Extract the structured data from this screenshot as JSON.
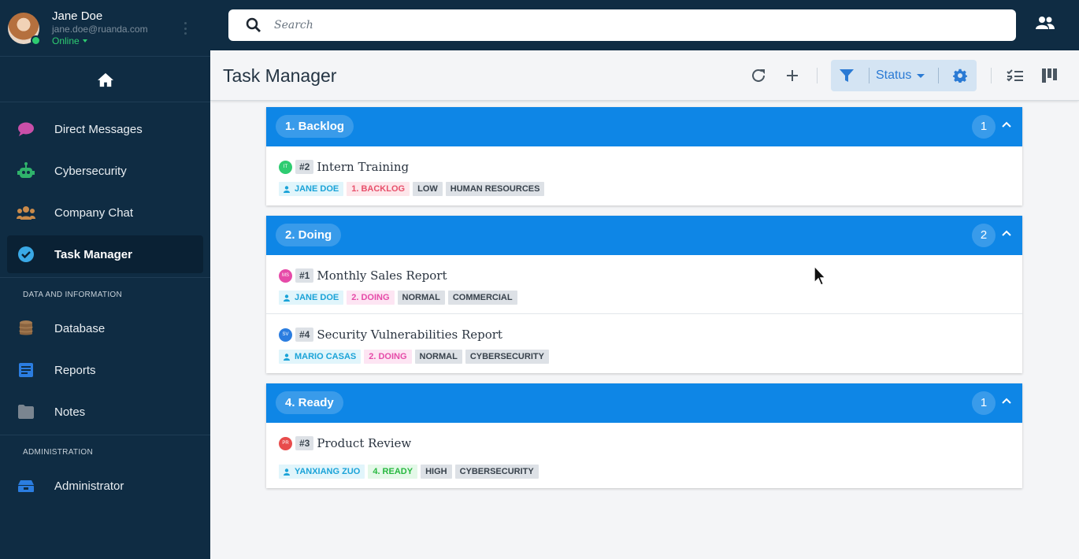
{
  "user": {
    "name": "Jane Doe",
    "email": "jane.doe@ruanda.com",
    "status": "Online"
  },
  "search": {
    "placeholder": "Search"
  },
  "sidebar": {
    "items": [
      {
        "label": "Direct Messages",
        "icon": "chat-bubble-icon",
        "color": "#c94fa8"
      },
      {
        "label": "Cybersecurity",
        "icon": "robot-icon",
        "color": "#2fb36b"
      },
      {
        "label": "Company Chat",
        "icon": "group-icon",
        "color": "#c98a4a"
      },
      {
        "label": "Task Manager",
        "icon": "check-circle-icon",
        "color": "#3aa9e6",
        "active": true
      }
    ],
    "section_data": "DATA AND INFORMATION",
    "data_items": [
      {
        "label": "Database",
        "icon": "database-icon",
        "color": "#a67c52"
      },
      {
        "label": "Reports",
        "icon": "document-icon",
        "color": "#2b7de0"
      },
      {
        "label": "Notes",
        "icon": "folder-icon",
        "color": "#7a8590"
      }
    ],
    "section_admin": "ADMINISTRATION",
    "admin_items": [
      {
        "label": "Administrator",
        "icon": "admin-icon",
        "color": "#2b7de0"
      }
    ]
  },
  "header": {
    "title": "Task Manager",
    "filter_label": "Status"
  },
  "groups": [
    {
      "title": "1. Backlog",
      "count": "1",
      "tasks": [
        {
          "initials": "IT",
          "avatar_color": "#2ecc71",
          "number": "#2",
          "title": "Intern Training",
          "assignee": "JANE DOE",
          "status": "1. BACKLOG",
          "priority": "LOW",
          "department": "HUMAN RESOURCES"
        }
      ]
    },
    {
      "title": "2. Doing",
      "count": "2",
      "tasks": [
        {
          "initials": "MS",
          "avatar_color": "#e64aa8",
          "number": "#1",
          "title": "Monthly Sales Report",
          "assignee": "JANE DOE",
          "status": "2. DOING",
          "priority": "NORMAL",
          "department": "COMMERCIAL"
        },
        {
          "initials": "SV",
          "avatar_color": "#2b7de0",
          "number": "#4",
          "title": "Security Vulnerabilities Report",
          "assignee": "MARIO CASAS",
          "status": "2. DOING",
          "priority": "NORMAL",
          "department": "CYBERSECURITY"
        }
      ]
    },
    {
      "title": "4. Ready",
      "count": "1",
      "tasks": [
        {
          "initials": "PR",
          "avatar_color": "#e84c4c",
          "number": "#3",
          "title": "Product Review",
          "assignee": "YANXIANG ZUO",
          "status": "4. READY",
          "priority": "HIGH",
          "department": "CYBERSECURITY"
        }
      ]
    }
  ]
}
